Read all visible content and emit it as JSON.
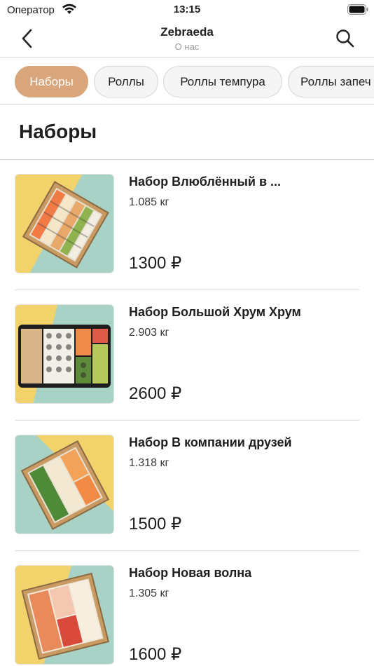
{
  "status_bar": {
    "carrier": "Оператор",
    "time": "13:15"
  },
  "nav": {
    "title": "Zebraeda",
    "subtitle": "О нас"
  },
  "tabs": [
    {
      "label": "Наборы",
      "active": true
    },
    {
      "label": "Роллы",
      "active": false
    },
    {
      "label": "Роллы темпура",
      "active": false
    },
    {
      "label": "Роллы запеч",
      "active": false
    }
  ],
  "section": {
    "title": "Наборы"
  },
  "products": [
    {
      "name": "Набор Влюблённый в ...",
      "weight": "1.085 кг",
      "price": "1300 ₽"
    },
    {
      "name": "Набор Большой Хрум Хрум",
      "weight": "2.903 кг",
      "price": "2600 ₽"
    },
    {
      "name": "Набор В компании друзей",
      "weight": "1.318 кг",
      "price": "1500 ₽"
    },
    {
      "name": "Набор Новая волна",
      "weight": "1.305 кг",
      "price": "1600 ₽"
    }
  ],
  "colors": {
    "accent": "#d9a57b",
    "photo_yellow": "#f2d36b",
    "photo_mint": "#a8d2c5"
  }
}
